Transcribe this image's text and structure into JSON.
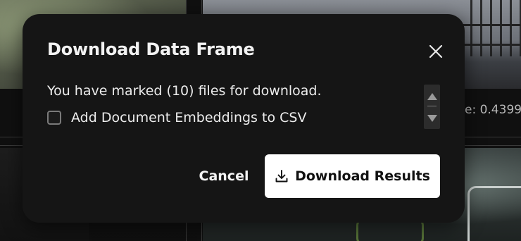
{
  "background": {
    "score_text": "e: 0.4399"
  },
  "dialog": {
    "title": "Download Data Frame",
    "close_icon": "close-icon",
    "message": "You have marked (10) files for download.",
    "checkbox": {
      "label": "Add Document Embeddings to CSV",
      "checked": false
    },
    "scrollbar": {
      "up_icon": "triangle-up-icon",
      "down_icon": "triangle-down-icon"
    },
    "cancel_label": "Cancel",
    "download_label": "Download Results",
    "download_icon": "download-icon"
  },
  "colors": {
    "dialog_background": "#151515",
    "primary_button_background": "#ffffff",
    "primary_button_text": "#111111",
    "text": "#ececec"
  }
}
